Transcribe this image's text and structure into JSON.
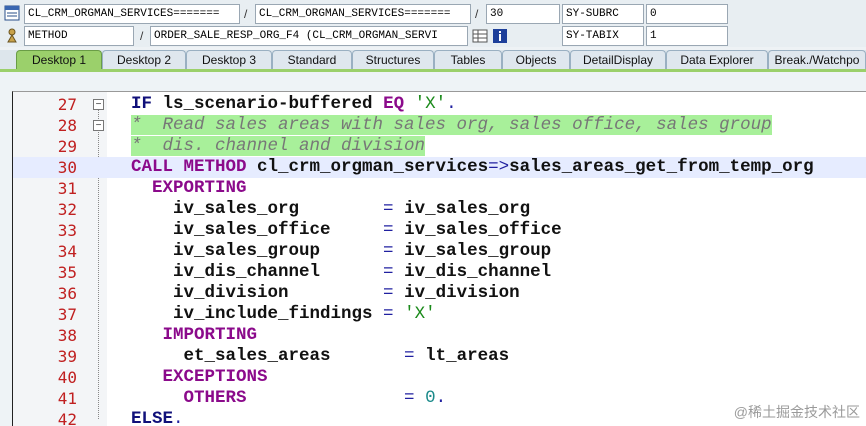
{
  "toolbar": {
    "row1": {
      "program": "CL_CRM_ORGMAN_SERVICES=======",
      "include": "CL_CRM_ORGMAN_SERVICES=======",
      "line": "30",
      "var_name": "SY-SUBRC",
      "var_value": "0"
    },
    "row2": {
      "event_type": "METHOD",
      "event": "ORDER_SALE_RESP_ORG_F4 (CL_CRM_ORGMAN_SERVI",
      "var_name": "SY-TABIX",
      "var_value": "1"
    },
    "slash": "/"
  },
  "tabs": [
    {
      "label": "Desktop 1",
      "active": true
    },
    {
      "label": "Desktop 2"
    },
    {
      "label": "Desktop 3"
    },
    {
      "label": "Standard"
    },
    {
      "label": "Structures"
    },
    {
      "label": "Tables"
    },
    {
      "label": "Objects"
    },
    {
      "label": "DetailDisplay"
    },
    {
      "label": "Data Explorer"
    },
    {
      "label": "Break./Watchpo"
    }
  ],
  "code": {
    "current_line": "30",
    "lines": [
      {
        "n": "27",
        "t": [
          [
            "IF ",
            "kw"
          ],
          [
            "ls_scenario-buffered ",
            "id"
          ],
          [
            "EQ ",
            "kwp"
          ],
          [
            "'X'",
            "str"
          ],
          [
            ".",
            "op"
          ]
        ]
      },
      {
        "n": "28",
        "t": [
          [
            "*  Read sales areas with sales org, sales office, sales group",
            "cm"
          ]
        ]
      },
      {
        "n": "29",
        "t": [
          [
            "*  dis. channel and division",
            "cm"
          ]
        ]
      },
      {
        "n": "30",
        "t": [
          [
            "CALL METHOD ",
            "kwp"
          ],
          [
            "cl_crm_orgman_services",
            "id"
          ],
          [
            "=>",
            "op"
          ],
          [
            "sales_areas_get_from_temp_org",
            "id"
          ]
        ]
      },
      {
        "n": "31",
        "t": [
          [
            "  EXPORTING",
            "kwp"
          ]
        ]
      },
      {
        "n": "32",
        "t": [
          [
            "    iv_sales_org        ",
            "id"
          ],
          [
            "= ",
            "op"
          ],
          [
            "iv_sales_org",
            "id"
          ]
        ]
      },
      {
        "n": "33",
        "t": [
          [
            "    iv_sales_office     ",
            "id"
          ],
          [
            "= ",
            "op"
          ],
          [
            "iv_sales_office",
            "id"
          ]
        ]
      },
      {
        "n": "34",
        "t": [
          [
            "    iv_sales_group      ",
            "id"
          ],
          [
            "= ",
            "op"
          ],
          [
            "iv_sales_group",
            "id"
          ]
        ]
      },
      {
        "n": "35",
        "t": [
          [
            "    iv_dis_channel      ",
            "id"
          ],
          [
            "= ",
            "op"
          ],
          [
            "iv_dis_channel",
            "id"
          ]
        ]
      },
      {
        "n": "36",
        "t": [
          [
            "    iv_division         ",
            "id"
          ],
          [
            "= ",
            "op"
          ],
          [
            "iv_division",
            "id"
          ]
        ]
      },
      {
        "n": "37",
        "t": [
          [
            "    iv_include_findings ",
            "id"
          ],
          [
            "= ",
            "op"
          ],
          [
            "'X'",
            "str"
          ]
        ]
      },
      {
        "n": "38",
        "t": [
          [
            "   IMPORTING",
            "kwp"
          ]
        ]
      },
      {
        "n": "39",
        "t": [
          [
            "     et_sales_areas       ",
            "id"
          ],
          [
            "= ",
            "op"
          ],
          [
            "lt_areas",
            "id"
          ]
        ]
      },
      {
        "n": "40",
        "t": [
          [
            "   EXCEPTIONS",
            "kwp"
          ]
        ]
      },
      {
        "n": "41",
        "t": [
          [
            "     OTHERS               ",
            "kwp"
          ],
          [
            "= ",
            "op"
          ],
          [
            "0",
            "num"
          ],
          [
            ".",
            "op"
          ]
        ]
      },
      {
        "n": "42",
        "t": [
          [
            "ELSE",
            "kw"
          ],
          [
            ".",
            "op"
          ]
        ]
      }
    ]
  },
  "watermark": "@稀土掘金技术社区",
  "colors": {
    "tab_active": "#9bd06b",
    "comment_bg": "#a8f09a",
    "line_number": "#c02020",
    "keyword": "#8b0a8b"
  }
}
